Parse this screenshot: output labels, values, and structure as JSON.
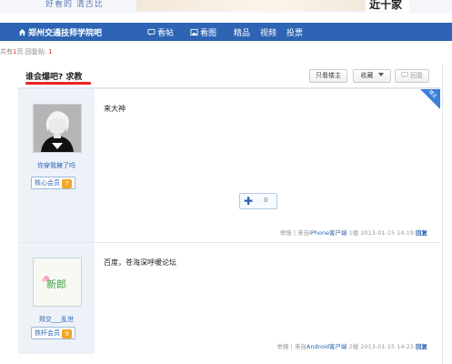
{
  "banner": {
    "left_text": "好看的  清古比",
    "promo_text": "近十家"
  },
  "nav": {
    "home": "郑州交通技师学院吧",
    "kantie": "看帖",
    "kantu": "看图",
    "jingpin": "精品",
    "shipin": "视频",
    "toupiao": "投票"
  },
  "meta": {
    "pages_prefix": "共有",
    "pages_value": "1",
    "pages_suffix": "页  回复贴: ",
    "replies_value": "1"
  },
  "thread": {
    "title": "谁会爆吧? 求教",
    "only_author": "只看楼主",
    "favorite": "收藏",
    "reply": "回复"
  },
  "posts": [
    {
      "username": "你穿我擁了吗",
      "rank": "核心会员",
      "level": "7",
      "content": "来大神",
      "plus_count": "0",
      "footer_report": "举报",
      "footer_from_prefix": "来自",
      "footer_client": "iPhone客户端",
      "footer_floor": "1楼",
      "footer_time": "2013-01-15 14:19",
      "footer_reply": "回复",
      "badge": "楼主"
    },
    {
      "username": "郑交___乱世",
      "rank": "铁杆会员",
      "level": "9",
      "content": "百度，苍海深呼暖论坛",
      "avatar_text": "新郎",
      "footer_report": "举报",
      "footer_from_prefix": "来自",
      "footer_client": "Android客户端",
      "footer_floor": "2楼",
      "footer_time": "2013-01-15 14:23",
      "footer_reply": "回复"
    }
  ],
  "colors": {
    "nav_bg": "#2d64b3",
    "accent_red": "#e22",
    "user_col_bg": "#edf2f8"
  },
  "icons": {
    "home": "home-icon",
    "kantie": "chat-bubble-icon",
    "kantu": "image-icon",
    "favorite_dropdown": "chevron-down-icon",
    "reply": "reply-bubble-icon",
    "plus": "plus-icon"
  }
}
